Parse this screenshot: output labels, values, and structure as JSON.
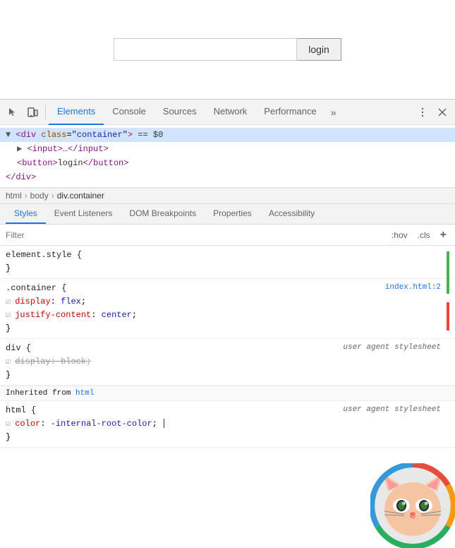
{
  "page": {
    "login_input_value": "",
    "login_button_label": "login"
  },
  "devtools": {
    "toolbar": {
      "tabs": [
        {
          "id": "elements",
          "label": "Elements",
          "active": true
        },
        {
          "id": "console",
          "label": "Console",
          "active": false
        },
        {
          "id": "sources",
          "label": "Sources",
          "active": false
        },
        {
          "id": "network",
          "label": "Network",
          "active": false
        },
        {
          "id": "performance",
          "label": "Performance",
          "active": false
        },
        {
          "id": "more",
          "label": "»",
          "active": false
        }
      ]
    },
    "html_tree": {
      "lines": [
        {
          "text": "▼ <div class=\"container\"> == $0",
          "indent": 0,
          "selected": true
        },
        {
          "text": "▶ <input>…</input>",
          "indent": 1
        },
        {
          "text": "<button>login</button>",
          "indent": 1
        },
        {
          "text": "</div>",
          "indent": 0
        }
      ]
    },
    "breadcrumb": {
      "items": [
        {
          "label": "html",
          "active": false
        },
        {
          "label": "body",
          "active": false
        },
        {
          "label": "div.container",
          "active": true
        }
      ]
    },
    "styles_tabs": {
      "tabs": [
        {
          "id": "styles",
          "label": "Styles",
          "active": true
        },
        {
          "id": "event-listeners",
          "label": "Event Listeners",
          "active": false
        },
        {
          "id": "dom-breakpoints",
          "label": "DOM Breakpoints",
          "active": false
        },
        {
          "id": "properties",
          "label": "Properties",
          "active": false
        },
        {
          "id": "accessibility",
          "label": "Accessibility",
          "active": false
        }
      ]
    },
    "filter": {
      "placeholder": "Filter",
      "hov_label": ":hov",
      "cls_label": ".cls",
      "plus_label": "+"
    },
    "style_rules": [
      {
        "id": "element-style",
        "selector": "element.style {",
        "closing": "}",
        "source": "",
        "properties": []
      },
      {
        "id": "container",
        "selector": ".container {",
        "closing": "}",
        "source": "index.html:2",
        "properties": [
          {
            "name": "display",
            "value": "flex",
            "strikethrough": false
          },
          {
            "name": "justify-content",
            "value": "center",
            "strikethrough": false
          }
        ]
      },
      {
        "id": "div-rule",
        "selector": "div {",
        "closing": "}",
        "source": "user agent stylesheet",
        "properties": [
          {
            "name": "display",
            "value": "block",
            "strikethrough": true
          }
        ]
      }
    ],
    "inherited": {
      "label": "Inherited from",
      "element": "html"
    },
    "inherited_rules": [
      {
        "id": "html-rule",
        "selector": "html {",
        "closing": "}",
        "source": "user agent stylesheet",
        "properties": [
          {
            "name": "color",
            "value": "-internal-root-color",
            "strikethrough": false
          }
        ]
      }
    ]
  }
}
